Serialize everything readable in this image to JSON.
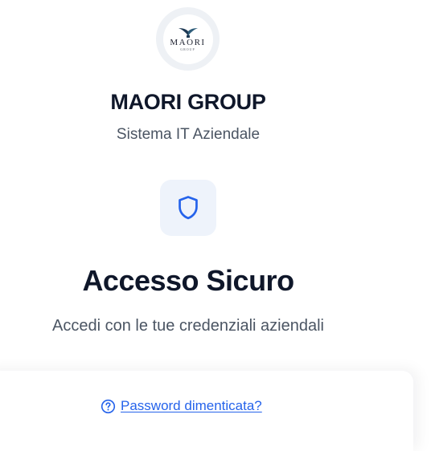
{
  "brand": {
    "logo_word": "MAORI",
    "logo_sub": "GROUP",
    "company_name": "MAORI GROUP",
    "company_subtitle": "Sistema IT Aziendale"
  },
  "login": {
    "icon": "shield-icon",
    "title": "Accesso Sicuro",
    "subtitle": "Accedi con le tue credenziali aziendali",
    "forgot_icon": "help-circle-icon",
    "forgot_password": "Password dimenticata?"
  },
  "colors": {
    "text_primary": "#0f172a",
    "text_secondary": "#4b5563",
    "accent": "#2563eb",
    "icon_bg": "#eef3fb",
    "logo_bg": "#eef1f5"
  }
}
